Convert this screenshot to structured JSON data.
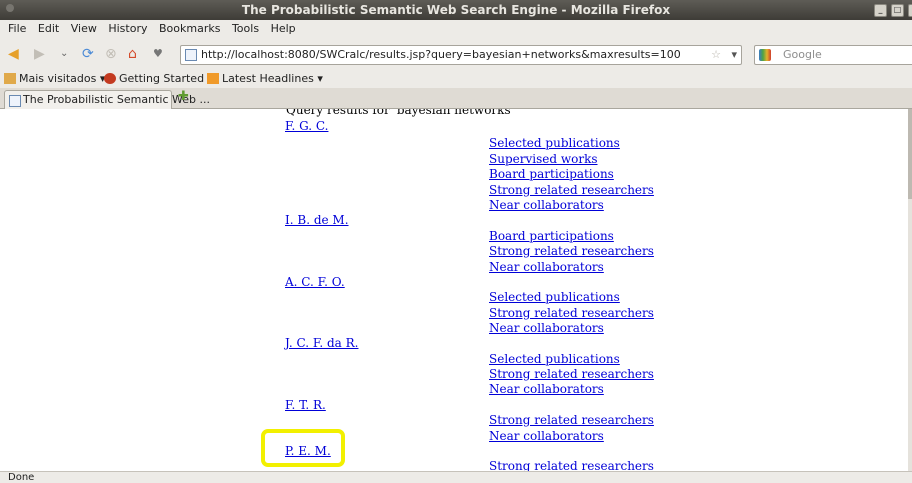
{
  "window": {
    "title": "The Probabilistic Semantic Web Search Engine - Mozilla Firefox"
  },
  "menu": [
    "File",
    "Edit",
    "View",
    "History",
    "Bookmarks",
    "Tools",
    "Help"
  ],
  "nav": {
    "url": "http://localhost:8080/SWCralc/results.jsp?query=bayesian+networks&maxresults=100",
    "search_placeholder": "Google"
  },
  "bookmarks": [
    "Mais visitados",
    "Getting Started",
    "Latest Headlines"
  ],
  "tab": {
    "label": "The Probabilistic Semantic Web ..."
  },
  "content": {
    "query_title": "Query results for 'bayesian networks'",
    "researchers": [
      {
        "name": "F. G. C.",
        "links": [
          "Selected publications",
          "Supervised works",
          "Board participations",
          "Strong related researchers",
          "Near collaborators"
        ]
      },
      {
        "name": "I. B. de M.",
        "links": [
          "Board participations",
          "Strong related researchers",
          "Near collaborators"
        ]
      },
      {
        "name": "A. C. F. O.",
        "links": [
          "Selected publications",
          "Strong related researchers",
          "Near collaborators"
        ]
      },
      {
        "name": "J. C. F. da R.",
        "links": [
          "Selected publications",
          "Strong related researchers",
          "Near collaborators"
        ]
      },
      {
        "name": "F. T. R.",
        "links": [
          "Strong related researchers",
          "Near collaborators"
        ]
      },
      {
        "name": "P. E. M.",
        "links": [
          "Strong related researchers"
        ]
      }
    ]
  },
  "status": "Done",
  "colors": {
    "link": "#0000d8",
    "highlight": "#f2f000"
  }
}
